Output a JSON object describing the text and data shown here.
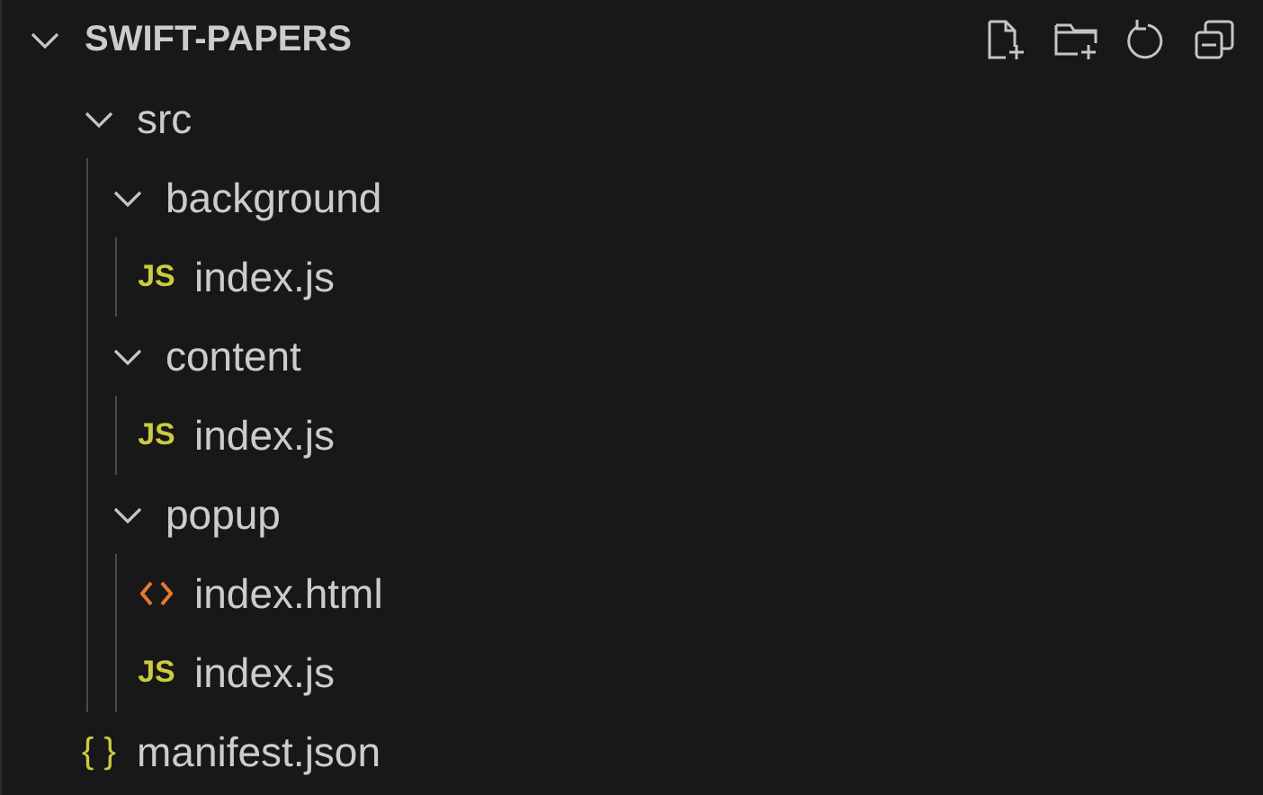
{
  "explorer": {
    "title": "SWIFT-PAPERS",
    "expanded": true
  },
  "tree": [
    {
      "name": "src",
      "kind": "folder",
      "expanded": true,
      "children": [
        {
          "name": "background",
          "kind": "folder",
          "expanded": true,
          "children": [
            {
              "name": "index.js",
              "kind": "js",
              "badge": "JS"
            }
          ]
        },
        {
          "name": "content",
          "kind": "folder",
          "expanded": true,
          "children": [
            {
              "name": "index.js",
              "kind": "js",
              "badge": "JS"
            }
          ]
        },
        {
          "name": "popup",
          "kind": "folder",
          "expanded": true,
          "children": [
            {
              "name": "index.html",
              "kind": "html"
            },
            {
              "name": "index.js",
              "kind": "js",
              "badge": "JS"
            }
          ]
        }
      ]
    },
    {
      "name": "manifest.json",
      "kind": "json",
      "badge": "{ }"
    }
  ]
}
